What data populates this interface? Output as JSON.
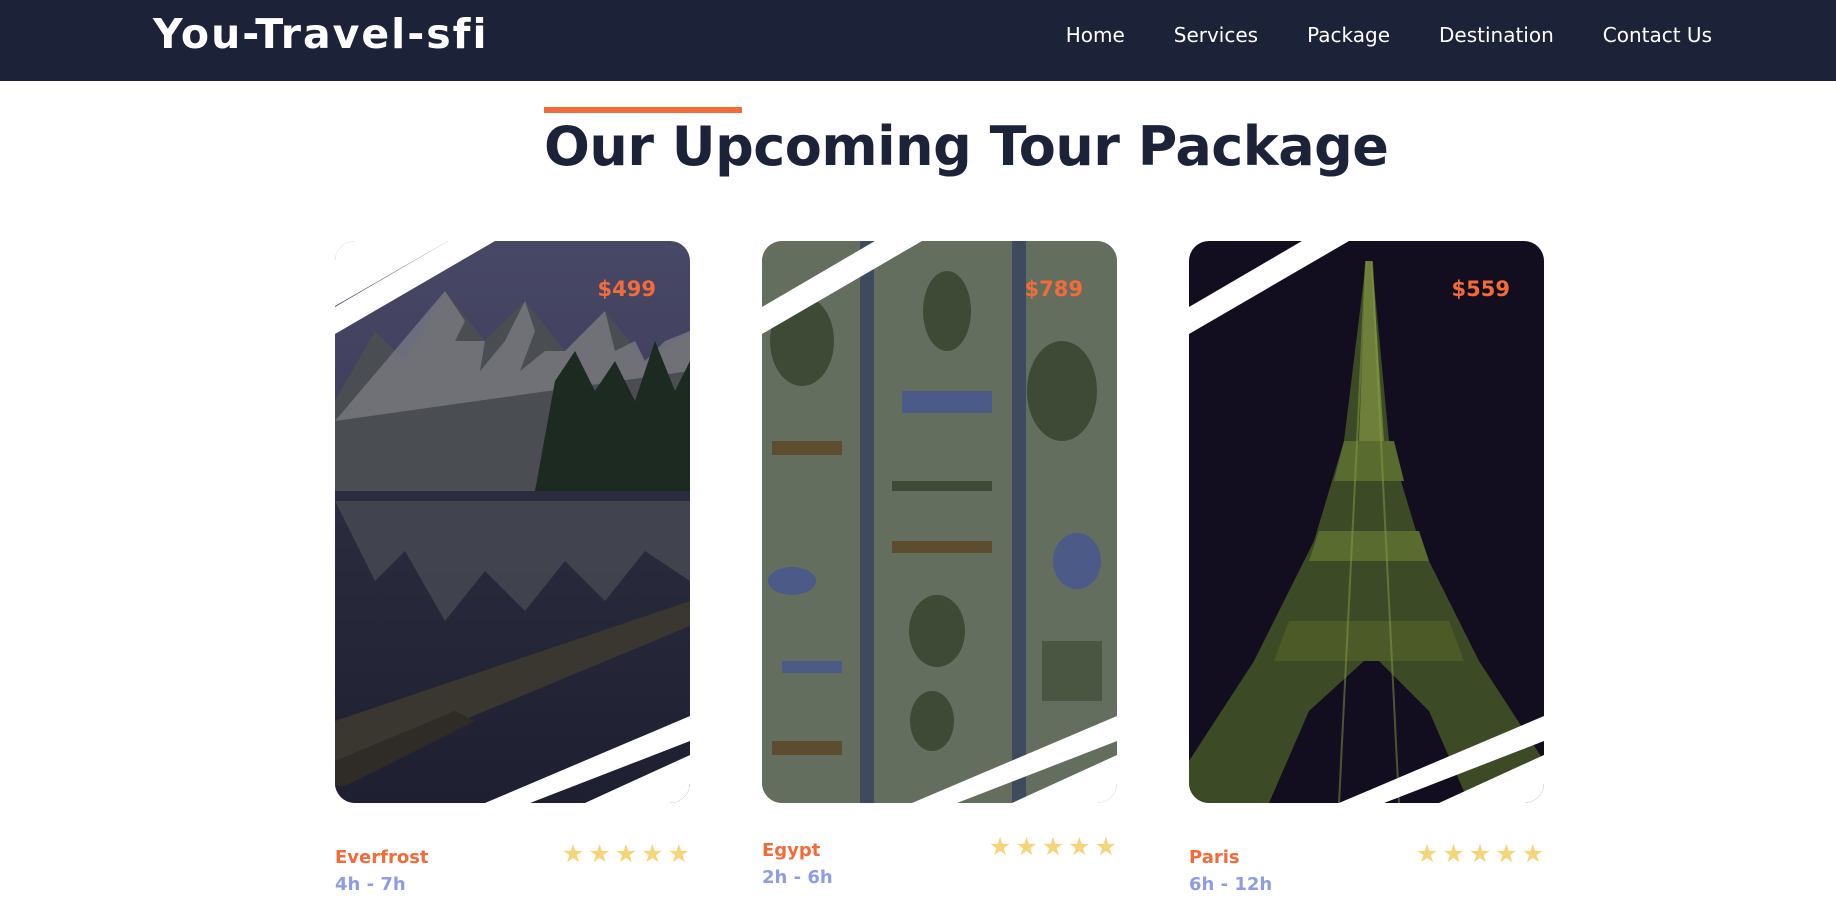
{
  "nav": {
    "brand": "You-Travel-sfi",
    "links": [
      "Home",
      "Services",
      "Package",
      "Destination",
      "Contact Us"
    ]
  },
  "section": {
    "title": "Our Upcoming Tour Package",
    "accent_color": "#f26b3a"
  },
  "cards": [
    {
      "price": "$499",
      "name": "Everfrost",
      "duration": "4h - 7h",
      "rating": 5,
      "image": "mountain-lake"
    },
    {
      "price": "$789",
      "name": "Egypt",
      "duration": "2h - 6h",
      "rating": 5,
      "image": "hieroglyphs"
    },
    {
      "price": "$559",
      "name": "Paris",
      "duration": "6h - 12h",
      "rating": 5,
      "image": "eiffel-tower-night"
    }
  ],
  "colors": {
    "navbar": "#1c2237",
    "accent": "#f26b3a",
    "duration": "#8f9be3",
    "star": "#f5d47a"
  }
}
